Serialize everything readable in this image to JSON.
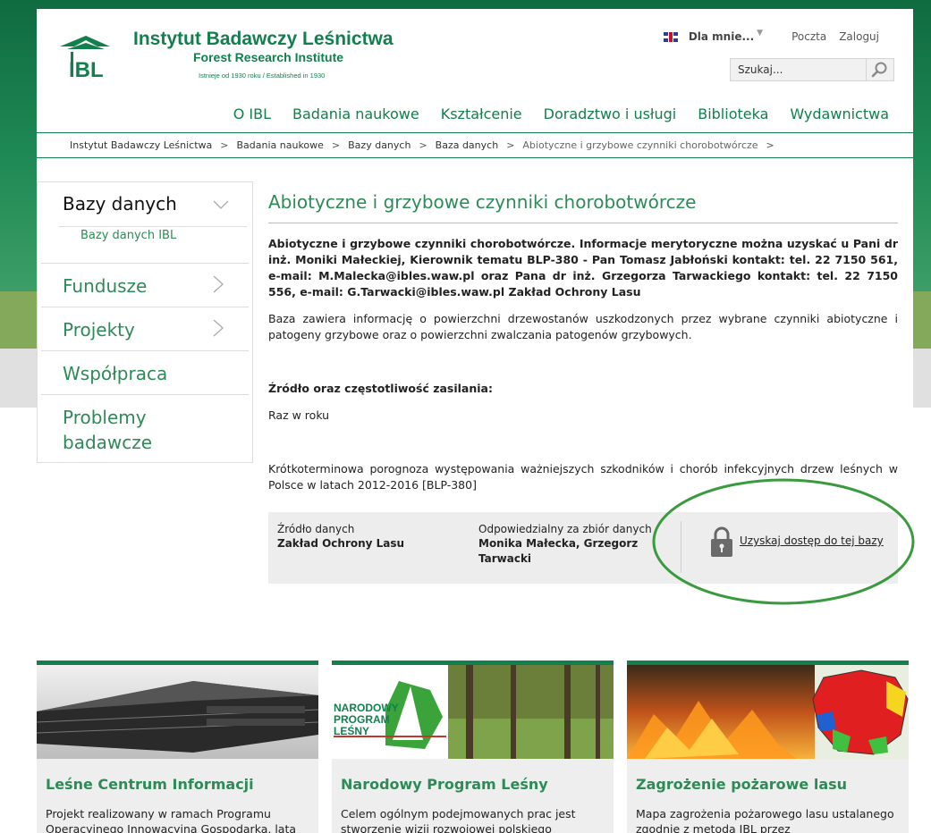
{
  "header": {
    "title": "Instytut Badawczy Leśnictwa",
    "subtitle": "Forest Research Institute",
    "established": "Istnieje od 1930 roku / Established in 1930",
    "logo_text": "IBL"
  },
  "utility": {
    "dla_label": "Dla mnie...",
    "poczta": "Poczta",
    "zaloguj": "Zaloguj"
  },
  "search": {
    "placeholder": "Szukaj..."
  },
  "nav": [
    "O IBL",
    "Badania naukowe",
    "Kształcenie",
    "Doradztwo i usługi",
    "Biblioteka",
    "Wydawnictwa"
  ],
  "breadcrumb": [
    "Instytut Badawczy Leśnictwa",
    "Badania naukowe",
    "Bazy danych",
    "Baza danych",
    "Abiotyczne i grzybowe czynniki chorobotwórcze"
  ],
  "breadcrumb_sep": ">",
  "sidebar": {
    "heading": "Bazy danych",
    "sub": "Bazy danych IBL",
    "items": [
      "Fundusze",
      "Projekty",
      "Współpraca",
      "Problemy badawcze"
    ]
  },
  "main": {
    "title": "Abiotyczne i grzybowe czynniki chorobotwórcze",
    "intro": "Abiotyczne i grzybowe czynniki chorobotwórcze. Informacje merytoryczne można uzyskać u Pani dr inż. Moniki Małeckiej, Kierownik tematu BLP-380 - Pan Tomasz Jabłoński kontakt: tel. 22 7150 561, e-mail: M.Malecka@ibles.waw.pl oraz Pana dr inż. Grzegorza Tarwackiego kontakt: tel. 22 7150 556, e-mail: G.Tarwacki@ibles.waw.pl Zakład Ochrony Lasu",
    "description": "Baza zawiera informację o powierzchni drzewostanów uszkodzonych przez wybrane czynniki abiotyczne i patogeny grzybowe oraz o powierzchni zwalczania patogenów grzybowych.",
    "source_heading": "Źródło oraz częstotliwość zasilania:",
    "source_value": "Raz w roku",
    "forecast": "Krótkoterminowa porognoza występowania ważniejszych szkodników i chorób infekcyjnych drzew leśnych w Polsce w latach 2012-2016 [BLP-380]"
  },
  "info_box": {
    "source_label": "Źródło danych",
    "source_value": "Zakład Ochrony Lasu",
    "resp_label": "Odpowiedzialny za zbiór danych",
    "resp_value": "Monika Małecka, Grzegorz Tarwacki",
    "access_link": "Uzyskaj dostęp do tej bazy"
  },
  "tiles": [
    {
      "title": "Leśne Centrum Informacji",
      "text": "Projekt realizowany w ramach Programu Operacyjnego Innowacyjna Gospodarka, lata"
    },
    {
      "title": "Narodowy Program Leśny",
      "text": "Celem ogólnym podejmowanych prac jest stworzenie wizji rozwojowej polskiego",
      "image_text": [
        "NARODOWY",
        "PROGRAM",
        "LEŚNY"
      ]
    },
    {
      "title": "Zagrożenie pożarowe lasu",
      "text": "Mapa zagrożenia pożarowego lasu ustalanego zgodnie z metodą IBL przez"
    }
  ],
  "colors": {
    "brand": "#127f4d",
    "link": "#2e8a57",
    "highlight_ellipse": "#3a9a3e"
  }
}
